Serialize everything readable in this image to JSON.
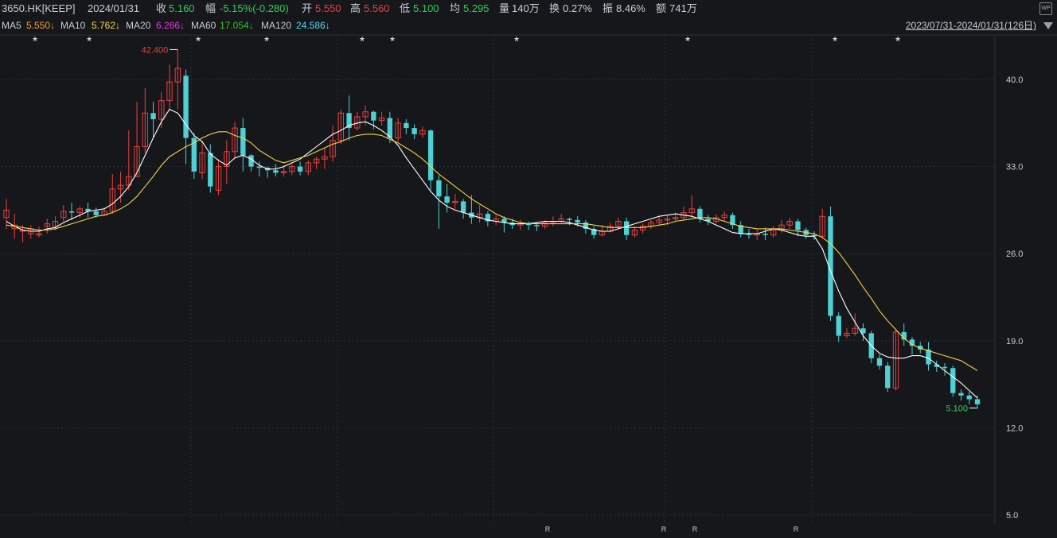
{
  "header": {
    "symbol": "3650.HK[KEEP]",
    "date": "2024/01/31",
    "close_label": "收",
    "close": "5.160",
    "change_label": "幅",
    "change": "-5.15%(-0.280)",
    "open_label": "开",
    "open": "5.550",
    "high_label": "高",
    "high": "5.560",
    "low_label": "低",
    "low": "5.100",
    "avg_label": "均",
    "avg": "5.295",
    "volume_label": "量",
    "volume": "140万",
    "turnover_label": "换",
    "turnover": "0.27%",
    "amplitude_label": "振",
    "amplitude": "8.46%",
    "amount_label": "额",
    "amount": "741万",
    "wp_icon": "WP"
  },
  "ma_bar": {
    "ma5_label": "MA5",
    "ma5": "5.550↓",
    "ma10_label": "MA10",
    "ma10": "5.762↓",
    "ma20_label": "MA20",
    "ma20": "6.266↓",
    "ma60_label": "MA60",
    "ma60": "17.054↓",
    "ma120_label": "MA120",
    "ma120": "24.586↓",
    "range": "2023/07/31-2024/01/31(126日)"
  },
  "colors": {
    "up": "#e8413f",
    "down": "#4fd0d4",
    "ma5": "#ffffff",
    "ma10": "#f5d442",
    "ma20": "#e636e6",
    "ma60": "#2fbf2f",
    "ma120": "#56d7f0",
    "grid": "#2c2f36",
    "text": "#c9ccd2"
  },
  "chart_data": {
    "type": "candlestick",
    "y_ticks": [
      "40.0",
      "33.0",
      "26.0",
      "19.0",
      "12.0",
      "5.0"
    ],
    "ylim": [
      5.0,
      40.0
    ],
    "max_label": "42.400",
    "min_label": "5.100",
    "star_markers": [
      "★",
      "★",
      "★",
      "★",
      "★",
      "★",
      "★",
      "★",
      "★",
      "★"
    ],
    "r_markers": [
      "R",
      "R",
      "R",
      "R"
    ],
    "candles": [
      [
        28.9,
        29.5,
        28.0,
        30.4
      ],
      [
        28.0,
        28.3,
        27.2,
        29.2
      ],
      [
        27.8,
        27.9,
        26.9,
        28.3
      ],
      [
        27.6,
        28.0,
        27.2,
        28.3
      ],
      [
        27.5,
        27.6,
        27.3,
        28.2
      ],
      [
        28.2,
        28.4,
        27.6,
        28.8
      ],
      [
        28.2,
        28.6,
        27.9,
        29.0
      ],
      [
        28.9,
        29.4,
        28.6,
        29.9
      ],
      [
        29.4,
        29.3,
        28.7,
        30.1
      ],
      [
        29.3,
        29.6,
        28.9,
        29.8
      ],
      [
        29.6,
        29.4,
        28.9,
        30.1
      ],
      [
        29.4,
        29.1,
        28.9,
        29.7
      ],
      [
        29.1,
        29.4,
        29.0,
        29.7
      ],
      [
        29.4,
        31.2,
        29.2,
        32.4
      ],
      [
        31.2,
        31.5,
        30.1,
        32.6
      ],
      [
        31.5,
        32.2,
        31.1,
        35.9
      ],
      [
        32.2,
        34.6,
        32.2,
        38.2
      ],
      [
        34.6,
        37.3,
        34.1,
        39.3
      ],
      [
        37.3,
        36.8,
        35.3,
        38.2
      ],
      [
        36.8,
        38.3,
        36.1,
        39.0
      ],
      [
        38.3,
        39.8,
        37.6,
        41.2
      ],
      [
        39.8,
        40.9,
        37.6,
        42.4
      ],
      [
        40.3,
        35.3,
        33.2,
        40.8
      ],
      [
        35.3,
        32.6,
        32.0,
        35.7
      ],
      [
        32.5,
        34.1,
        32.0,
        35.0
      ],
      [
        34.1,
        31.4,
        30.9,
        34.8
      ],
      [
        31.1,
        33.0,
        30.7,
        33.6
      ],
      [
        33.0,
        34.2,
        31.6,
        35.1
      ],
      [
        34.2,
        36.1,
        33.6,
        36.6
      ],
      [
        36.1,
        33.9,
        32.6,
        36.9
      ],
      [
        33.9,
        33.0,
        32.6,
        34.0
      ],
      [
        33.0,
        32.9,
        32.2,
        33.4
      ],
      [
        32.9,
        32.7,
        32.1,
        33.0
      ],
      [
        32.7,
        32.5,
        32.2,
        33.2
      ],
      [
        32.5,
        32.6,
        32.2,
        33.1
      ],
      [
        32.6,
        33.0,
        32.3,
        33.2
      ],
      [
        33.0,
        32.6,
        32.3,
        33.4
      ],
      [
        32.6,
        33.3,
        32.3,
        33.5
      ],
      [
        33.3,
        33.6,
        32.8,
        33.8
      ],
      [
        33.6,
        33.8,
        32.8,
        34.5
      ],
      [
        33.8,
        35.1,
        33.4,
        36.3
      ],
      [
        35.1,
        37.3,
        34.8,
        37.6
      ],
      [
        37.3,
        36.1,
        35.1,
        38.7
      ],
      [
        36.1,
        37.0,
        35.9,
        37.4
      ],
      [
        37.0,
        37.4,
        36.3,
        37.9
      ],
      [
        37.4,
        36.7,
        36.0,
        37.5
      ],
      [
        36.7,
        36.9,
        36.3,
        37.4
      ],
      [
        36.9,
        35.3,
        34.9,
        37.4
      ],
      [
        35.3,
        36.5,
        35.0,
        36.9
      ],
      [
        36.5,
        36.1,
        35.6,
        36.8
      ],
      [
        36.1,
        35.6,
        35.2,
        36.4
      ],
      [
        35.6,
        35.9,
        35.3,
        36.2
      ],
      [
        35.9,
        31.9,
        31.1,
        36.0
      ],
      [
        31.9,
        30.6,
        28.0,
        32.3
      ],
      [
        30.6,
        30.1,
        29.3,
        31.6
      ],
      [
        30.1,
        30.2,
        29.6,
        30.8
      ],
      [
        30.2,
        29.3,
        28.8,
        30.4
      ],
      [
        29.3,
        28.9,
        28.4,
        30.7
      ],
      [
        28.9,
        29.2,
        28.5,
        29.9
      ],
      [
        29.2,
        28.6,
        28.2,
        29.4
      ],
      [
        28.6,
        28.8,
        28.3,
        29.1
      ],
      [
        28.8,
        28.5,
        27.7,
        29.0
      ],
      [
        28.5,
        28.3,
        28.0,
        28.8
      ],
      [
        28.3,
        28.4,
        27.9,
        28.7
      ],
      [
        28.4,
        28.3,
        27.9,
        28.6
      ],
      [
        28.3,
        28.2,
        27.8,
        28.5
      ],
      [
        28.2,
        28.5,
        28.0,
        28.7
      ],
      [
        28.5,
        28.6,
        28.2,
        29.0
      ],
      [
        28.6,
        28.8,
        28.4,
        29.2
      ],
      [
        28.8,
        28.7,
        28.3,
        28.9
      ],
      [
        28.7,
        28.5,
        28.2,
        29.0
      ],
      [
        28.5,
        28.0,
        27.6,
        28.7
      ],
      [
        28.0,
        27.5,
        27.2,
        28.2
      ],
      [
        27.5,
        27.8,
        27.4,
        28.3
      ],
      [
        27.8,
        28.2,
        27.7,
        28.5
      ],
      [
        28.2,
        28.6,
        28.0,
        28.9
      ],
      [
        28.6,
        27.5,
        27.1,
        28.9
      ],
      [
        27.5,
        27.9,
        27.3,
        28.2
      ],
      [
        27.9,
        28.2,
        27.6,
        28.4
      ],
      [
        28.2,
        28.5,
        28.0,
        28.7
      ],
      [
        28.5,
        28.7,
        28.3,
        29.0
      ],
      [
        28.7,
        28.8,
        28.3,
        29.1
      ],
      [
        28.8,
        28.9,
        28.6,
        29.3
      ],
      [
        28.9,
        29.3,
        28.7,
        29.8
      ],
      [
        29.3,
        29.6,
        28.9,
        30.7
      ],
      [
        29.6,
        28.8,
        28.5,
        29.8
      ],
      [
        28.8,
        28.6,
        28.3,
        29.1
      ],
      [
        28.6,
        28.9,
        28.4,
        29.2
      ],
      [
        28.9,
        29.1,
        28.6,
        29.4
      ],
      [
        29.1,
        28.3,
        28.0,
        29.3
      ],
      [
        28.3,
        27.6,
        27.3,
        28.6
      ],
      [
        27.6,
        27.5,
        27.2,
        28.0
      ],
      [
        27.5,
        27.6,
        27.1,
        28.0
      ],
      [
        27.6,
        27.5,
        27.1,
        28.1
      ],
      [
        27.5,
        27.9,
        27.3,
        28.2
      ],
      [
        27.9,
        28.3,
        27.7,
        28.7
      ],
      [
        28.3,
        28.6,
        28.0,
        28.9
      ],
      [
        28.6,
        27.9,
        27.4,
        28.8
      ],
      [
        27.9,
        27.5,
        27.2,
        28.1
      ],
      [
        27.5,
        27.4,
        27.1,
        27.8
      ],
      [
        27.4,
        29.0,
        27.2,
        29.6
      ],
      [
        29.0,
        21.0,
        20.6,
        29.8
      ],
      [
        21.0,
        19.4,
        18.9,
        21.3
      ],
      [
        19.4,
        19.6,
        19.2,
        20.0
      ],
      [
        19.6,
        20.0,
        19.4,
        21.2
      ],
      [
        20.0,
        19.6,
        19.0,
        20.4
      ],
      [
        19.6,
        17.6,
        17.2,
        19.8
      ],
      [
        17.6,
        17.0,
        16.7,
        17.9
      ],
      [
        17.0,
        15.2,
        14.9,
        17.3
      ],
      [
        15.2,
        19.7,
        15.0,
        19.9
      ],
      [
        19.7,
        19.1,
        18.6,
        20.4
      ],
      [
        19.1,
        18.6,
        17.9,
        19.3
      ],
      [
        18.6,
        18.3,
        18.0,
        18.9
      ],
      [
        18.3,
        17.1,
        16.6,
        18.9
      ],
      [
        17.1,
        16.9,
        16.5,
        17.4
      ],
      [
        16.9,
        16.8,
        16.2,
        17.2
      ],
      [
        16.8,
        14.8,
        14.5,
        17.0
      ],
      [
        14.8,
        14.6,
        14.2,
        15.1
      ],
      [
        14.6,
        14.3,
        13.9,
        14.9
      ],
      [
        14.3,
        13.9,
        13.6,
        14.6
      ]
    ],
    "ma5": [
      28.6,
      28.2,
      27.9,
      27.8,
      27.8,
      28.0,
      28.1,
      28.5,
      28.8,
      29.1,
      29.4,
      29.5,
      29.6,
      30.0,
      30.6,
      31.4,
      32.5,
      33.9,
      35.3,
      36.6,
      37.6,
      37.3,
      36.4,
      35.5,
      35.0,
      34.0,
      33.5,
      33.1,
      33.7,
      33.9,
      33.6,
      33.1,
      32.8,
      32.8,
      33.0,
      33.3,
      33.6,
      34.1,
      34.6,
      35.1,
      35.6,
      35.9,
      36.3,
      36.5,
      36.6,
      36.3,
      35.9,
      35.4,
      34.7,
      33.7,
      32.8,
      31.9,
      31.0,
      30.3,
      29.8,
      29.5,
      29.3,
      29.1,
      28.9,
      28.7,
      28.6,
      28.5,
      28.4,
      28.4,
      28.4,
      28.5,
      28.6,
      28.6,
      28.6,
      28.5,
      28.3,
      28.1,
      27.9,
      27.8,
      27.8,
      28.0,
      28.2,
      28.4,
      28.6,
      28.8,
      29.0,
      29.1,
      29.2,
      29.1,
      29.0,
      28.8,
      28.6,
      28.3,
      28.0,
      27.7,
      27.6,
      27.6,
      27.6,
      27.8,
      28.0,
      27.9,
      27.7,
      27.5,
      27.4,
      27.4,
      26.4,
      24.6,
      23.0,
      21.6,
      20.5,
      19.4,
      18.6,
      18.0,
      17.7,
      17.6,
      17.6,
      17.8,
      17.8,
      17.6,
      17.1,
      16.6,
      16.1,
      15.6,
      15.0,
      14.4
    ],
    "ma10": [
      28.3,
      28.2,
      28.1,
      28.0,
      27.9,
      27.9,
      28.0,
      28.2,
      28.4,
      28.6,
      28.8,
      29.0,
      29.1,
      29.3,
      29.6,
      30.0,
      30.6,
      31.4,
      32.2,
      33.1,
      33.8,
      34.2,
      34.6,
      34.9,
      35.3,
      35.6,
      35.8,
      35.8,
      35.5,
      35.3,
      34.9,
      34.3,
      33.9,
      33.5,
      33.3,
      33.5,
      33.7,
      33.9,
      34.2,
      34.5,
      34.8,
      35.0,
      35.3,
      35.5,
      35.6,
      35.6,
      35.5,
      35.2,
      34.9,
      34.5,
      34.1,
      33.6,
      33.0,
      32.4,
      31.9,
      31.4,
      30.9,
      30.4,
      30.0,
      29.6,
      29.2,
      28.9,
      28.7,
      28.5,
      28.4,
      28.4,
      28.4,
      28.4,
      28.4,
      28.4,
      28.4,
      28.4,
      28.3,
      28.2,
      28.1,
      28.1,
      28.1,
      28.1,
      28.1,
      28.2,
      28.3,
      28.4,
      28.6,
      28.7,
      28.8,
      28.9,
      28.9,
      28.8,
      28.6,
      28.4,
      28.2,
      28.1,
      28.0,
      28.0,
      28.0,
      28.0,
      27.9,
      27.8,
      27.7,
      27.6,
      27.3,
      26.8,
      26.1,
      25.2,
      24.3,
      23.3,
      22.4,
      21.4,
      20.6,
      19.9,
      19.2,
      18.7,
      18.4,
      18.2,
      18.0,
      17.8,
      17.6,
      17.4,
      17.0,
      16.6
    ]
  }
}
